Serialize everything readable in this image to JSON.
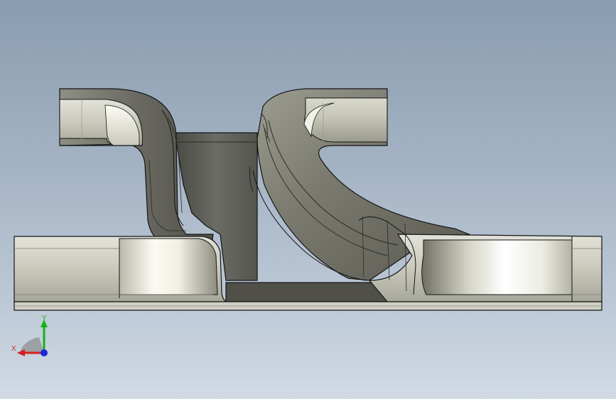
{
  "viewport": {
    "background_top": "#8a9cb0",
    "background_bottom": "#d1dae5"
  },
  "model": {
    "body_color": "#c9c9bc",
    "highlight_color": "#fafaf2",
    "shadow_color": "#5e5e58",
    "edge_color": "#141414"
  },
  "triad": {
    "x_label": "X",
    "y_label": "Y",
    "x_color": "#d42020",
    "y_color": "#18b018",
    "z_color": "#1a2ad6"
  }
}
